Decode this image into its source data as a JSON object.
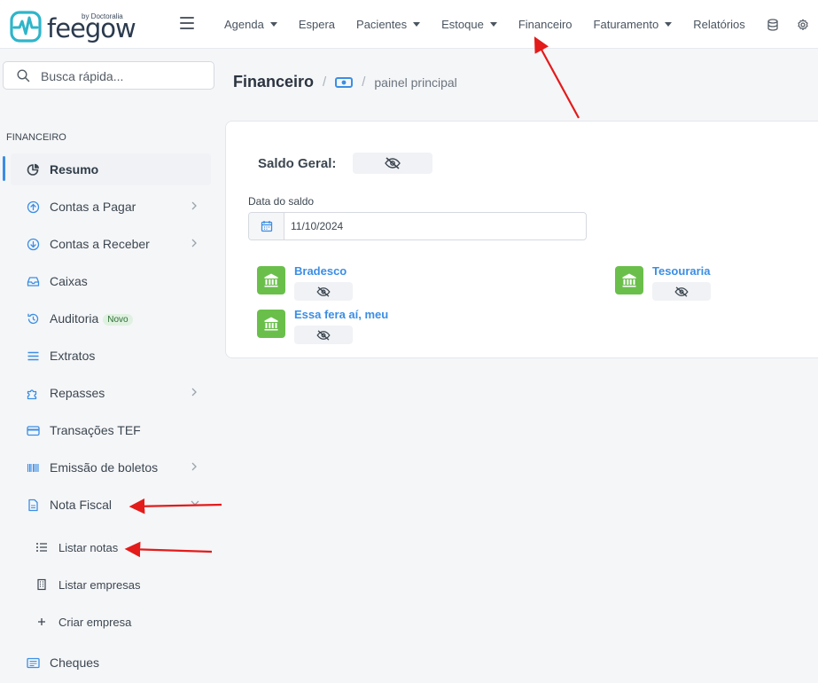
{
  "brand": {
    "name": "feegow",
    "sub": "by Doctoralia"
  },
  "nav": {
    "items": [
      {
        "label": "Agenda",
        "dropdown": true
      },
      {
        "label": "Espera",
        "dropdown": false
      },
      {
        "label": "Pacientes",
        "dropdown": true
      },
      {
        "label": "Estoque",
        "dropdown": true
      },
      {
        "label": "Financeiro",
        "dropdown": false
      },
      {
        "label": "Faturamento",
        "dropdown": true
      },
      {
        "label": "Relatórios",
        "dropdown": false
      }
    ],
    "icons": [
      "database-icon",
      "gear-icon"
    ]
  },
  "sidebar": {
    "search_placeholder": "Busca rápida...",
    "section": "FINANCEIRO",
    "items": [
      {
        "label": "Resumo",
        "icon": "pie-chart-icon",
        "active": true
      },
      {
        "label": "Contas a Pagar",
        "icon": "arrow-up-circle-icon",
        "chevron": true
      },
      {
        "label": "Contas a Receber",
        "icon": "arrow-down-circle-icon",
        "chevron": true
      },
      {
        "label": "Caixas",
        "icon": "inbox-icon"
      },
      {
        "label": "Auditoria",
        "icon": "history-icon",
        "badge": "Novo"
      },
      {
        "label": "Extratos",
        "icon": "list-icon"
      },
      {
        "label": "Repasses",
        "icon": "puzzle-icon",
        "chevron": true
      },
      {
        "label": "Transações TEF",
        "icon": "credit-card-icon"
      },
      {
        "label": "Emissão de boletos",
        "icon": "barcode-icon",
        "chevron": true
      },
      {
        "label": "Nota Fiscal",
        "icon": "file-icon",
        "chevron": true
      },
      {
        "label": "Cheques",
        "icon": "cheque-icon"
      }
    ],
    "subitems": [
      {
        "label": "Listar notas",
        "icon": "list-ul-icon"
      },
      {
        "label": "Listar empresas",
        "icon": "building-icon"
      },
      {
        "label": "Criar empresa",
        "icon": "plus-icon"
      }
    ]
  },
  "breadcrumb": {
    "title": "Financeiro",
    "current": "painel principal"
  },
  "panel": {
    "saldo_label": "Saldo Geral:",
    "date_label": "Data do saldo",
    "date_value": "11/10/2024",
    "accounts": [
      {
        "name": "Bradesco"
      },
      {
        "name": "Tesouraria"
      },
      {
        "name": "Essa fera aí, meu"
      }
    ]
  },
  "colors": {
    "accent": "#3b8ee4",
    "bank": "#6abf4b",
    "annotation": "#e31b1b"
  }
}
